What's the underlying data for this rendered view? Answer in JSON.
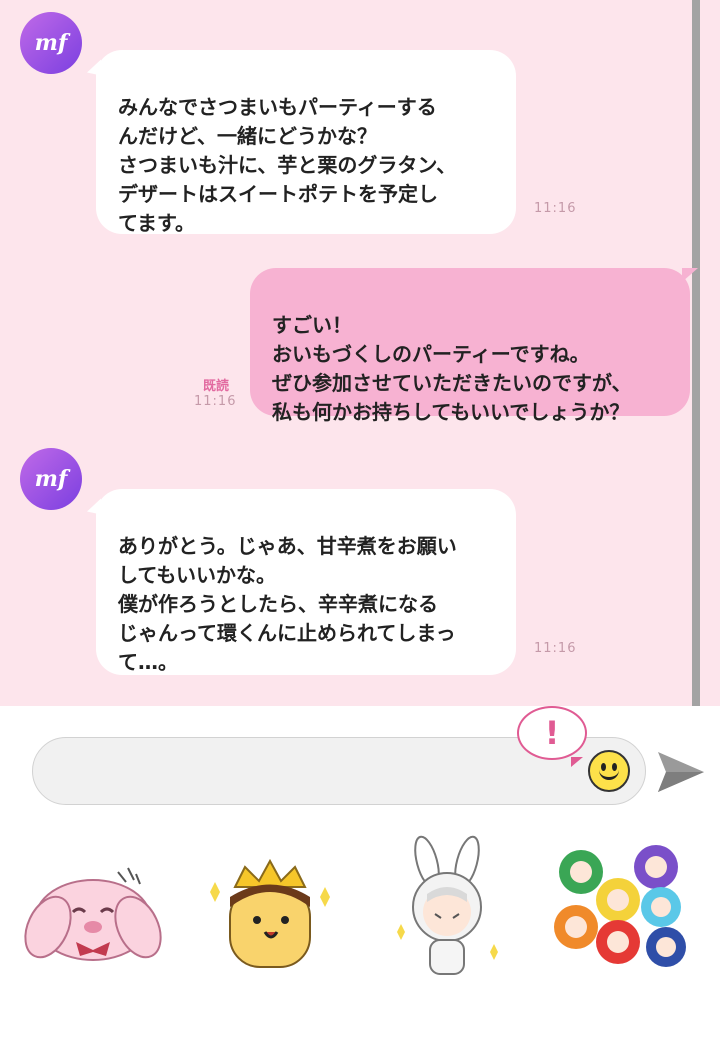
{
  "avatar_label": "mf",
  "messages": [
    {
      "text": "みんなでさつまいもパーティーする\nんだけど、一緒にどうかな？\nさつまいも汁に、芋と栗のグラタン、\nデザートはスイートポテトを予定し\nてます。",
      "time": "11:16"
    },
    {
      "text": "すごい！\nおいもづくしのパーティーですね。\nぜひ参加させていただきたいのですが、\n私も何かお持ちしてもいいでしょうか？",
      "time": "11:16",
      "read": "既読"
    },
    {
      "text": "ありがとう。じゃあ、甘辛煮をお願い\nしてもいいかな。\n僕が作ろうとしたら、辛辛煮になる\nじゃんって環くんに止められてしまっ\nて…。",
      "time": "11:16"
    }
  ],
  "composer": {
    "placeholder": "",
    "alert_symbol": "!",
    "emoji_icon": "smiley-icon",
    "send_icon": "send-arrow-icon"
  },
  "stickers": [
    {
      "icon": "pink-bunny-sticker"
    },
    {
      "icon": "crowned-pudding-sticker"
    },
    {
      "icon": "bunny-hood-boy-sticker"
    },
    {
      "icon": "colorful-group-sticker"
    }
  ],
  "colors": {
    "chat_bg": "#fde5ec",
    "outgoing_bubble": "#f7b2d2",
    "avatar": "#9b4fe6",
    "accent": "#e05b93"
  }
}
